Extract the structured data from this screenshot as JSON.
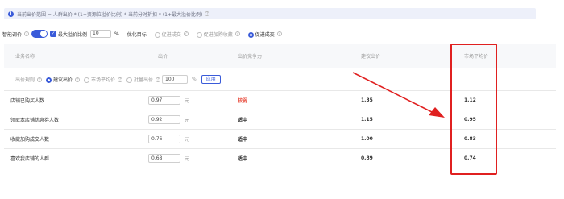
{
  "formula": {
    "text": "当前出价范围 = 人群出价 * (1+资源位溢价比例) * 当前分时折扣 * (1+最大溢价比例)"
  },
  "controls": {
    "smart_premium_label": "智能调价",
    "max_premium_label": "最大溢价比例",
    "max_premium_value": "10",
    "percent": "%",
    "goal_label": "优化目标",
    "goal_options": [
      "促进成交",
      "促进加购收藏",
      "促进成交"
    ],
    "goal_selected_index": 2
  },
  "table": {
    "headers": {
      "name": "业务名称",
      "bid": "出价",
      "competition": "出价竞争力",
      "suggested": "建议出价",
      "market": "市场平均价"
    },
    "batch": {
      "label": "出价规则",
      "options": [
        "建议出价",
        "市场平均价",
        "批量出价"
      ],
      "selected_index": 0,
      "value": "100",
      "percent": "%",
      "apply_label": "应用"
    },
    "rows": [
      {
        "name": "店铺已购买人数",
        "bid": "0.97",
        "unit": "元",
        "competition": "较弱",
        "competition_color": "#e84b3c",
        "suggested": "1.35",
        "market": "1.12"
      },
      {
        "name": "领取本店铺优惠券人数",
        "bid": "0.92",
        "unit": "元",
        "competition": "适中",
        "competition_color": "#222222",
        "suggested": "1.15",
        "market": "0.95"
      },
      {
        "name": "收藏加购成交人数",
        "bid": "0.76",
        "unit": "元",
        "competition": "适中",
        "competition_color": "#222222",
        "suggested": "1.00",
        "market": "0.83"
      },
      {
        "name": "喜欢我店铺的人群",
        "bid": "0.68",
        "unit": "元",
        "competition": "适中",
        "competition_color": "#222222",
        "suggested": "0.89",
        "market": "0.74"
      }
    ]
  },
  "colors": {
    "accent": "#3a5bd9",
    "annotation": "#e02020",
    "weak": "#e84b3c"
  }
}
